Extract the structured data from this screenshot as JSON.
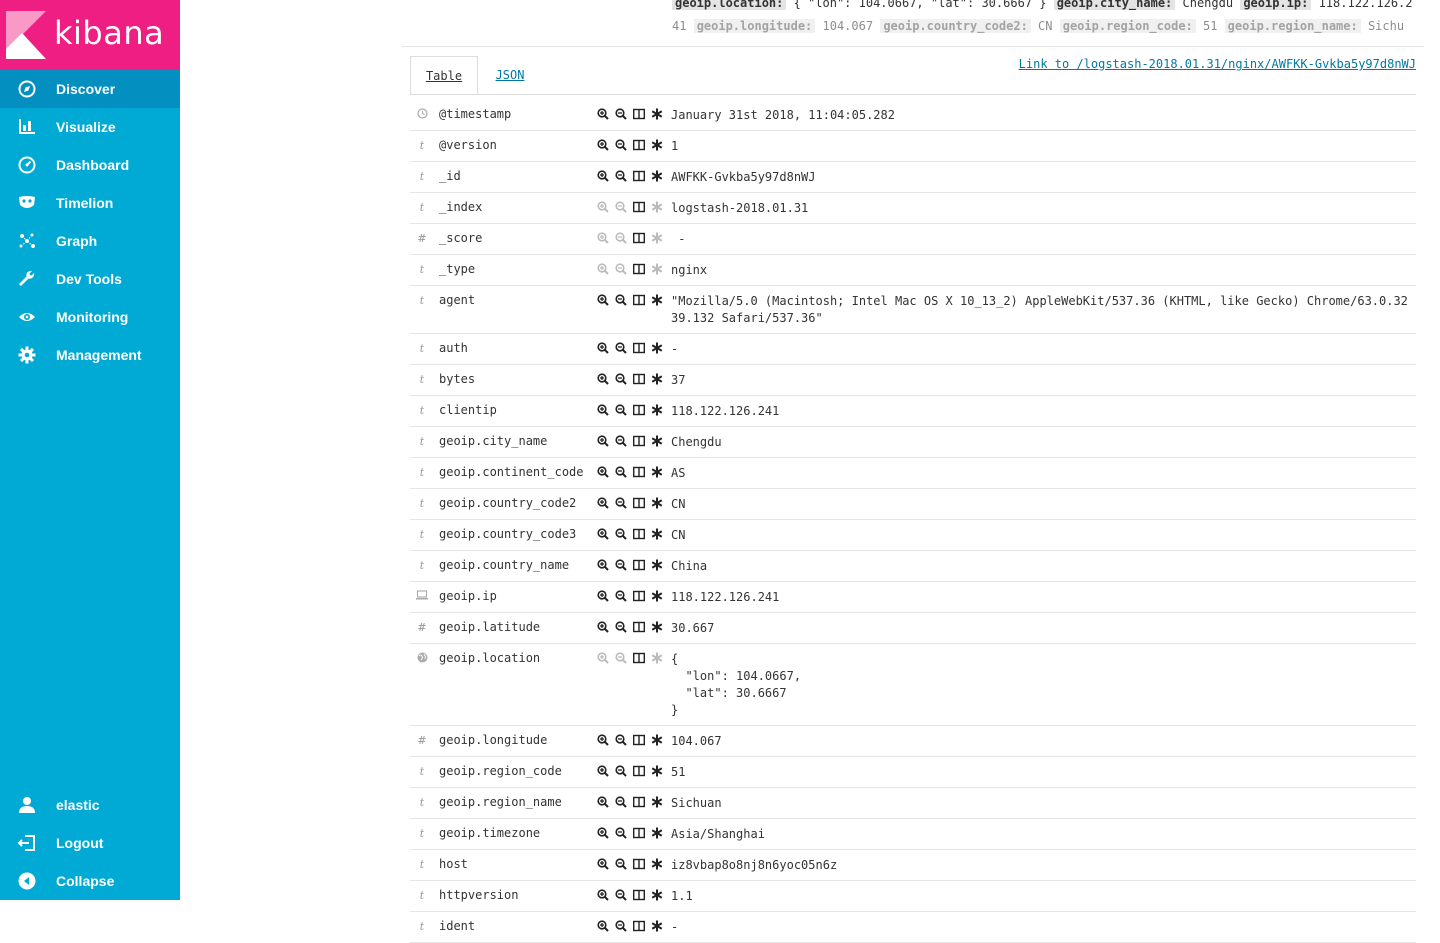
{
  "app": {
    "name": "kibana"
  },
  "colors": {
    "sidebar": "#00aad4",
    "logo_bg": "#ef1e82",
    "link": "#0079a5"
  },
  "nav": [
    {
      "label": "Discover",
      "icon": "compass-icon",
      "active": true
    },
    {
      "label": "Visualize",
      "icon": "bar-chart-icon"
    },
    {
      "label": "Dashboard",
      "icon": "dashboard-gauge-icon"
    },
    {
      "label": "Timelion",
      "icon": "timelion-mask-icon"
    },
    {
      "label": "Graph",
      "icon": "graph-network-icon"
    },
    {
      "label": "Dev Tools",
      "icon": "wrench-icon"
    },
    {
      "label": "Monitoring",
      "icon": "eye-icon"
    },
    {
      "label": "Management",
      "icon": "gear-icon"
    }
  ],
  "footer_nav": [
    {
      "label": "elastic",
      "icon": "user-icon"
    },
    {
      "label": "Logout",
      "icon": "logout-icon"
    },
    {
      "label": "Collapse",
      "icon": "collapse-arrow-icon"
    }
  ],
  "summary_line1": [
    {
      "key": "geoip.location:",
      "value": " { \"lon\": 104.0667, \"lat\": 30.6667 } "
    },
    {
      "key": "geoip.city_name:",
      "value": " Chengdu "
    },
    {
      "key": "geoip.ip:",
      "value": " 118.122.126.2"
    }
  ],
  "summary_line2_prefix": "41 ",
  "summary_line2": [
    {
      "key": "geoip.longitude:",
      "value": " 104.067 "
    },
    {
      "key": "geoip.country_code2:",
      "value": " CN "
    },
    {
      "key": "geoip.region_code:",
      "value": " 51 "
    },
    {
      "key": "geoip.region_name:",
      "value": " Sichu"
    }
  ],
  "tabs": {
    "table": "Table",
    "json": "JSON"
  },
  "doc_link": "Link to /logstash-2018.01.31/nginx/AWFKK-Gvkba5y97d8nWJ",
  "rows": [
    {
      "type": "clock",
      "field": "@timestamp",
      "value": "January 31st 2018, 11:04:05.282",
      "dim": false
    },
    {
      "type": "t",
      "field": "@version",
      "value": "1",
      "dim": false
    },
    {
      "type": "t",
      "field": "_id",
      "value": "AWFKK-Gvkba5y97d8nWJ",
      "dim": false
    },
    {
      "type": "t",
      "field": "_index",
      "value": "logstash-2018.01.31",
      "dim": true
    },
    {
      "type": "#",
      "field": "_score",
      "value": " -",
      "dim": true
    },
    {
      "type": "t",
      "field": "_type",
      "value": "nginx",
      "dim": true
    },
    {
      "type": "t",
      "field": "agent",
      "value": "\"Mozilla/5.0 (Macintosh; Intel Mac OS X 10_13_2) AppleWebKit/537.36 (KHTML, like Gecko) Chrome/63.0.32\n39.132 Safari/537.36\"",
      "dim": false
    },
    {
      "type": "t",
      "field": "auth",
      "value": "-",
      "dim": false
    },
    {
      "type": "t",
      "field": "bytes",
      "value": "37",
      "dim": false
    },
    {
      "type": "t",
      "field": "clientip",
      "value": "118.122.126.241",
      "dim": false
    },
    {
      "type": "t",
      "field": "geoip.city_name",
      "value": "Chengdu",
      "dim": false
    },
    {
      "type": "t",
      "field": "geoip.continent_code",
      "value": "AS",
      "dim": false
    },
    {
      "type": "t",
      "field": "geoip.country_code2",
      "value": "CN",
      "dim": false
    },
    {
      "type": "t",
      "field": "geoip.country_code3",
      "value": "CN",
      "dim": false
    },
    {
      "type": "t",
      "field": "geoip.country_name",
      "value": "China",
      "dim": false
    },
    {
      "type": "ip",
      "field": "geoip.ip",
      "value": "118.122.126.241",
      "dim": false
    },
    {
      "type": "#",
      "field": "geoip.latitude",
      "value": "30.667",
      "dim": false
    },
    {
      "type": "geo",
      "field": "geoip.location",
      "value": "{\n  \"lon\": 104.0667,\n  \"lat\": 30.6667\n}",
      "dim": true
    },
    {
      "type": "#",
      "field": "geoip.longitude",
      "value": "104.067",
      "dim": false
    },
    {
      "type": "t",
      "field": "geoip.region_code",
      "value": "51",
      "dim": false
    },
    {
      "type": "t",
      "field": "geoip.region_name",
      "value": "Sichuan",
      "dim": false
    },
    {
      "type": "t",
      "field": "geoip.timezone",
      "value": "Asia/Shanghai",
      "dim": false
    },
    {
      "type": "t",
      "field": "host",
      "value": "iz8vbap8o8nj8n6yoc05n6z",
      "dim": false
    },
    {
      "type": "t",
      "field": "httpversion",
      "value": "1.1",
      "dim": false
    },
    {
      "type": "t",
      "field": "ident",
      "value": "-",
      "dim": false
    }
  ]
}
